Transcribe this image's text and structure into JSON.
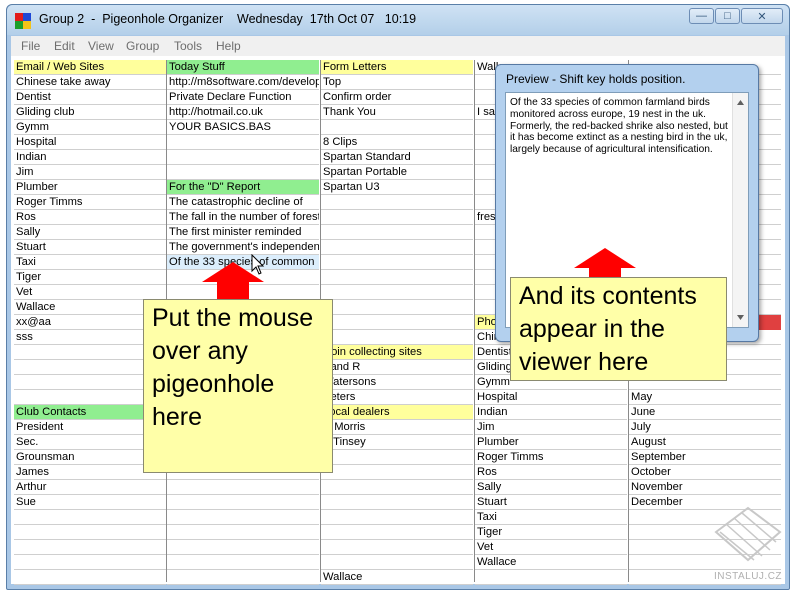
{
  "window": {
    "title": "Group 2  -  Pigeonhole Organizer    Wednesday  17th Oct 07   10:19",
    "minimize": "—",
    "maximize": "□",
    "close": "✕"
  },
  "menu": [
    "File",
    "Edit",
    "View",
    "Group",
    "Tools",
    "Help"
  ],
  "columns": [
    {
      "cells": [
        {
          "text": "Email / Web Sites",
          "bg": "#ffff9c"
        },
        {
          "text": "Chinese take away"
        },
        {
          "text": "Dentist"
        },
        {
          "text": "Gliding club"
        },
        {
          "text": "Gymm"
        },
        {
          "text": "Hospital"
        },
        {
          "text": "Indian"
        },
        {
          "text": "Jim"
        },
        {
          "text": "Plumber"
        },
        {
          "text": "Roger Timms"
        },
        {
          "text": "Ros"
        },
        {
          "text": "Sally"
        },
        {
          "text": "Stuart"
        },
        {
          "text": "Taxi"
        },
        {
          "text": "Tiger"
        },
        {
          "text": "Vet"
        },
        {
          "text": "Wallace"
        },
        {
          "text": "xx@aa"
        },
        {
          "text": "sss"
        },
        {
          "text": ""
        },
        {
          "text": ""
        },
        {
          "text": ""
        },
        {
          "text": ""
        },
        {
          "text": "Club Contacts",
          "bg": "#90ee90"
        },
        {
          "text": "President"
        },
        {
          "text": "Sec."
        },
        {
          "text": "Grounsman"
        },
        {
          "text": "James"
        },
        {
          "text": "Arthur"
        },
        {
          "text": "Sue"
        },
        {
          "text": ""
        },
        {
          "text": ""
        },
        {
          "text": ""
        },
        {
          "text": ""
        },
        {
          "text": ""
        }
      ]
    },
    {
      "cells": [
        {
          "text": "Today Stuff",
          "bg": "#90ee90"
        },
        {
          "text": "http://m8software.com/develop"
        },
        {
          "text": "Private Declare Function"
        },
        {
          "text": "http://hotmail.co.uk"
        },
        {
          "text": "YOUR BASICS.BAS"
        },
        {
          "text": ""
        },
        {
          "text": ""
        },
        {
          "text": ""
        },
        {
          "text": "For the \"D\" Report",
          "bg": "#90ee90"
        },
        {
          "text": "The catastrophic decline of"
        },
        {
          "text": "The fall in the number of forest"
        },
        {
          "text": "The first minister reminded"
        },
        {
          "text": "The government's independent"
        },
        {
          "text": "Of the 33 species of common",
          "bg": "#dceefc"
        },
        {
          "text": ""
        },
        {
          "text": ""
        },
        {
          "text": ""
        },
        {
          "text": ""
        },
        {
          "text": ""
        },
        {
          "text": ""
        },
        {
          "text": ""
        },
        {
          "text": ""
        },
        {
          "text": ""
        },
        {
          "text": ""
        },
        {
          "text": ""
        },
        {
          "text": ""
        },
        {
          "text": ""
        },
        {
          "text": ""
        },
        {
          "text": ""
        },
        {
          "text": ""
        },
        {
          "text": ""
        },
        {
          "text": ""
        },
        {
          "text": ""
        },
        {
          "text": ""
        },
        {
          "text": ""
        }
      ]
    },
    {
      "cells": [
        {
          "text": "Form Letters",
          "bg": "#ffff9c"
        },
        {
          "text": "Top"
        },
        {
          "text": "Confirm order"
        },
        {
          "text": "Thank You"
        },
        {
          "text": ""
        },
        {
          "text": "8 Clips"
        },
        {
          "text": "Spartan Standard"
        },
        {
          "text": "Spartan Portable"
        },
        {
          "text": "Spartan U3"
        },
        {
          "text": ""
        },
        {
          "text": ""
        },
        {
          "text": ""
        },
        {
          "text": ""
        },
        {
          "text": ""
        },
        {
          "text": ""
        },
        {
          "text": ""
        },
        {
          "text": ""
        },
        {
          "text": ""
        },
        {
          "text": ""
        },
        {
          "text": "Coin collecting sites",
          "bg": "#ffff9c"
        },
        {
          "text": "Band R"
        },
        {
          "text": "Watersons"
        },
        {
          "text": "Peters"
        },
        {
          "text": "Local dealers",
          "bg": "#ffff9c"
        },
        {
          "text": "D Morris"
        },
        {
          "text": "P Tinsey"
        },
        {
          "text": ""
        },
        {
          "text": ""
        },
        {
          "text": ""
        },
        {
          "text": ""
        },
        {
          "text": ""
        },
        {
          "text": ""
        },
        {
          "text": ""
        },
        {
          "text": ""
        },
        {
          "text": "Wallace"
        }
      ]
    },
    {
      "cells": [
        {
          "text": "Wallace"
        },
        {
          "text": ""
        },
        {
          "text": ""
        },
        {
          "text": "I sav"
        },
        {
          "text": ""
        },
        {
          "text": ""
        },
        {
          "text": ""
        },
        {
          "text": ""
        },
        {
          "text": ""
        },
        {
          "text": ""
        },
        {
          "text": "fres"
        },
        {
          "text": ""
        },
        {
          "text": ""
        },
        {
          "text": ""
        },
        {
          "text": ""
        },
        {
          "text": ""
        },
        {
          "text": ""
        },
        {
          "text": "Pho",
          "bg": "#ffff9c"
        },
        {
          "text": "Chin"
        },
        {
          "text": "Dentist"
        },
        {
          "text": "Gliding"
        },
        {
          "text": "Gymm"
        },
        {
          "text": "Hospital"
        },
        {
          "text": "Indian"
        },
        {
          "text": "Jim"
        },
        {
          "text": "Plumber"
        },
        {
          "text": "Roger Timms"
        },
        {
          "text": "Ros"
        },
        {
          "text": "Sally"
        },
        {
          "text": "Stuart"
        },
        {
          "text": "Taxi"
        },
        {
          "text": "Tiger"
        },
        {
          "text": "Vet"
        },
        {
          "text": "Wallace"
        },
        {
          "text": ""
        }
      ]
    },
    {
      "cells": [
        {
          "text": ""
        },
        {
          "text": ""
        },
        {
          "text": ""
        },
        {
          "text": ""
        },
        {
          "text": ""
        },
        {
          "text": ""
        },
        {
          "text": ""
        },
        {
          "text": ""
        },
        {
          "text": ""
        },
        {
          "text": ""
        },
        {
          "text": ""
        },
        {
          "text": ""
        },
        {
          "text": ""
        },
        {
          "text": ""
        },
        {
          "text": ""
        },
        {
          "text": ""
        },
        {
          "text": ""
        },
        {
          "text": "",
          "bg": "#ffff9c"
        },
        {
          "text": ""
        },
        {
          "text": ""
        },
        {
          "text": ""
        },
        {
          "text": ""
        },
        {
          "text": "May"
        },
        {
          "text": "June"
        },
        {
          "text": "July"
        },
        {
          "text": "August"
        },
        {
          "text": "September"
        },
        {
          "text": "October"
        },
        {
          "text": "November"
        },
        {
          "text": "December"
        },
        {
          "text": ""
        },
        {
          "text": ""
        },
        {
          "text": ""
        },
        {
          "text": ""
        },
        {
          "text": ""
        }
      ]
    }
  ],
  "notes": {
    "mouse": "Put the mouse over any pigeonhole here",
    "viewer": "And its contents appear in the viewer here"
  },
  "preview": {
    "title": "Preview - Shift key holds position.",
    "text": "Of the 33 species of common farmland birds monitored across europe, 19 nest in the uk. Formerly, the red-backed shrike also nested, but it has become extinct as a nesting bird in the uk, largely because of agricultural intensification."
  },
  "watermark": "INSTALUJ.CZ",
  "colors": {
    "yellow_header": "#ffff9c",
    "green_header": "#90ee90",
    "note_bg": "#ffffa8",
    "arrow": "#ff0000"
  }
}
